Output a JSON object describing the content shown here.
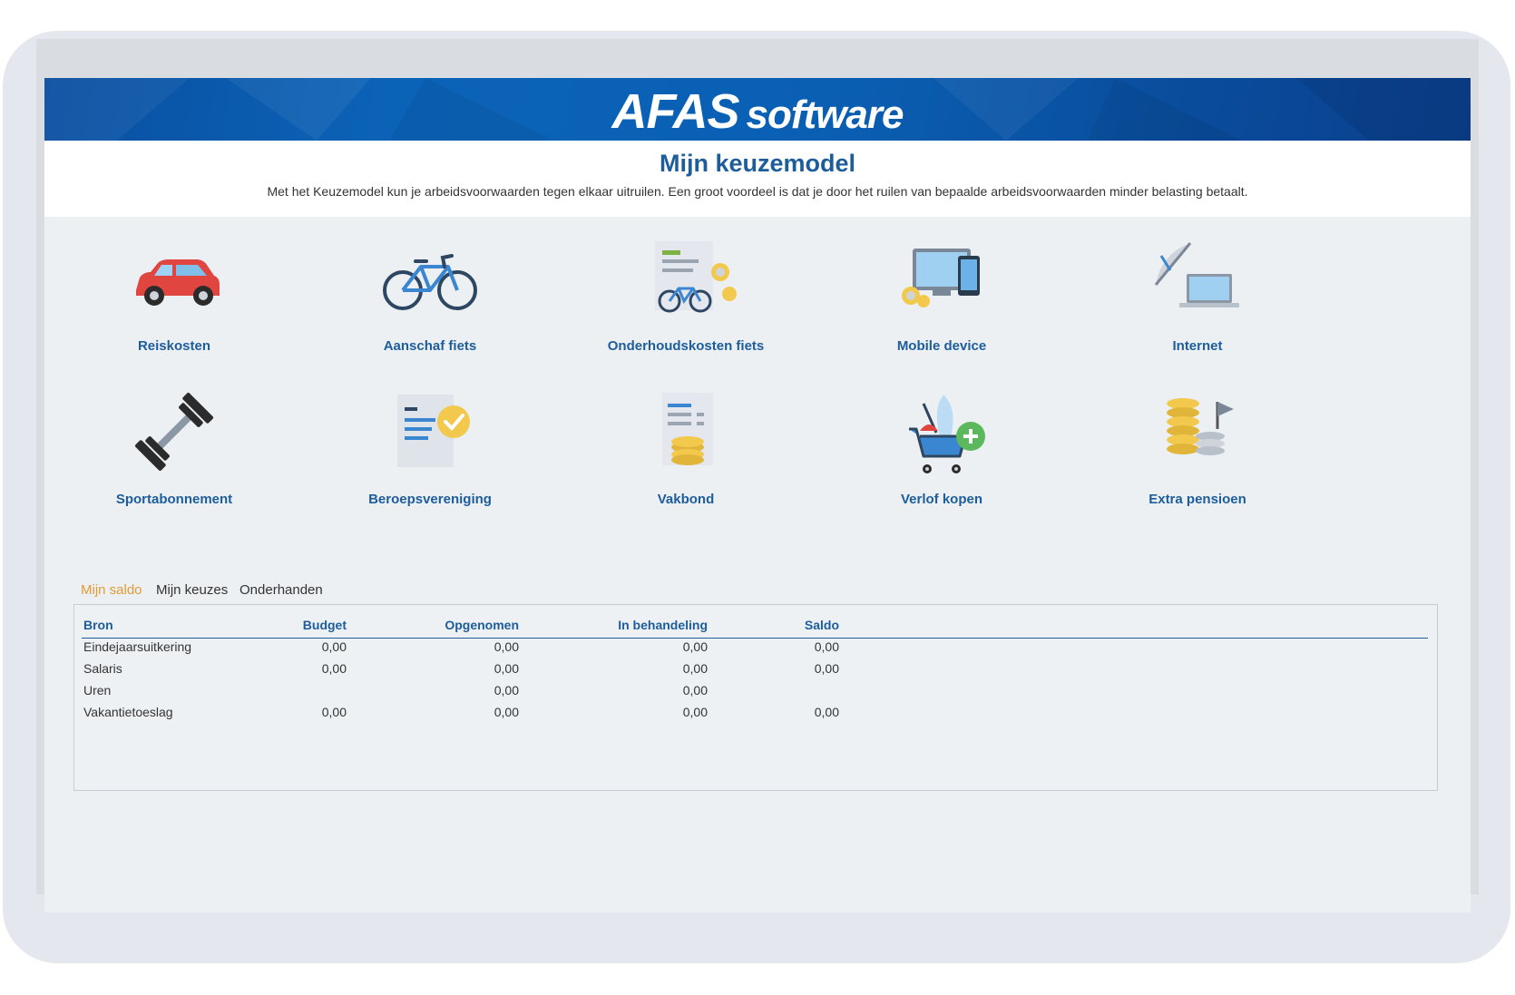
{
  "brand": {
    "primary": "AFAS",
    "secondary": "software",
    "color": "#0b5cb0"
  },
  "header": {
    "title": "Mijn keuzemodel",
    "description": "Met het Keuzemodel kun je arbeidsvoorwaarden tegen elkaar uitruilen. Een groot voordeel is dat je door het ruilen van bepaalde arbeidsvoorwaarden minder belasting betaalt."
  },
  "tiles": [
    {
      "label": "Reiskosten",
      "icon": "car-icon"
    },
    {
      "label": "Aanschaf fiets",
      "icon": "bicycle-icon"
    },
    {
      "label": "Onderhoudskosten fiets",
      "icon": "bike-maintenance-icon"
    },
    {
      "label": "Mobile device",
      "icon": "mobile-device-icon"
    },
    {
      "label": "Internet",
      "icon": "internet-icon"
    },
    {
      "label": "Sportabonnement",
      "icon": "dumbbell-icon"
    },
    {
      "label": "Beroepsvereniging",
      "icon": "certificate-icon"
    },
    {
      "label": "Vakbond",
      "icon": "union-icon"
    },
    {
      "label": "Verlof kopen",
      "icon": "shopping-cart-icon"
    },
    {
      "label": "Extra pensioen",
      "icon": "coins-flag-icon"
    }
  ],
  "tabs": [
    {
      "label": "Mijn saldo",
      "active": true
    },
    {
      "label": "Mijn keuzes",
      "active": false
    },
    {
      "label": "Onderhanden",
      "active": false
    }
  ],
  "table": {
    "columns": [
      "Bron",
      "Budget",
      "Opgenomen",
      "In behandeling",
      "Saldo"
    ],
    "rows": [
      [
        "Eindejaarsuitkering",
        "0,00",
        "0,00",
        "0,00",
        "0,00"
      ],
      [
        "Salaris",
        "0,00",
        "0,00",
        "0,00",
        "0,00"
      ],
      [
        "Uren",
        "",
        "0,00",
        "0,00",
        ""
      ],
      [
        "Vakantietoeslag",
        "0,00",
        "0,00",
        "0,00",
        "0,00"
      ]
    ]
  },
  "colors": {
    "accent": "#1d5d9b",
    "active_tab": "#e29a35",
    "banner": "#0b5cb0"
  }
}
